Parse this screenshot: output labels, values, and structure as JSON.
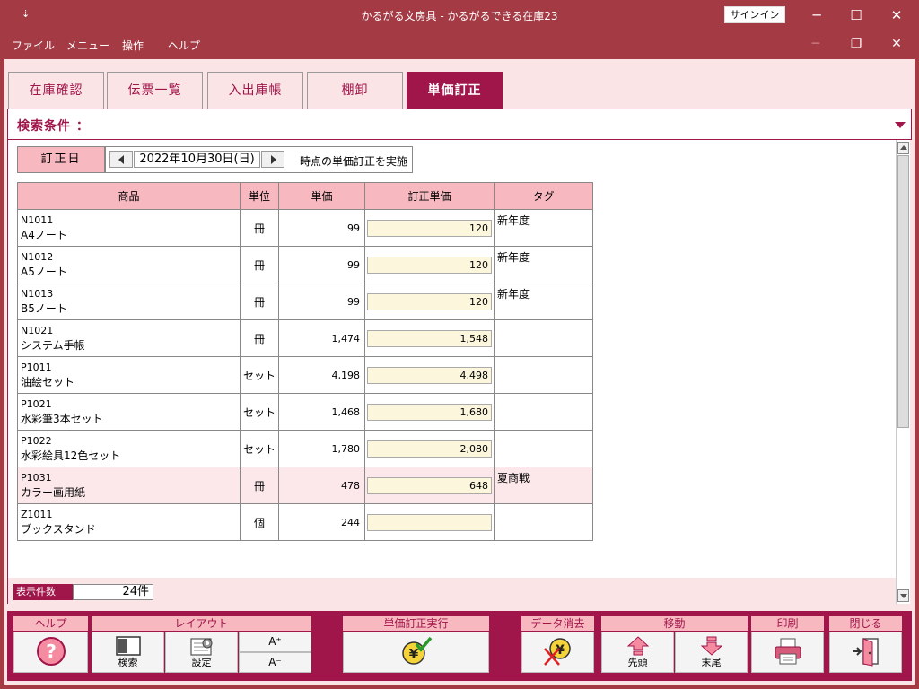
{
  "window": {
    "quick_access": "⇣",
    "title": "かるがる文房具  -  かるがるできる在庫23",
    "signin": "サインイン",
    "minimize": "─",
    "maximize": "☐",
    "close": "✕"
  },
  "menu": {
    "items": [
      "ファイル",
      "メニュー",
      "操作",
      "ヘルプ"
    ],
    "doc_minimize": "─",
    "doc_restore": "❐",
    "doc_close": "✕"
  },
  "tabs": [
    "在庫確認",
    "伝票一覧",
    "入出庫帳",
    "棚卸",
    "単価訂正"
  ],
  "active_tab": "単価訂正",
  "search": {
    "label": "検索条件 ："
  },
  "date_filter": {
    "label": "訂正日",
    "value": "2022年10月30日(日)",
    "note": "時点の単価訂正を実施"
  },
  "table": {
    "headers": [
      "商品",
      "単位",
      "単価",
      "訂正単価",
      "タグ"
    ],
    "rows": [
      {
        "code": "N1011",
        "name": "A4ノート",
        "unit": "冊",
        "price": "99",
        "corrected": "120",
        "tag": "新年度"
      },
      {
        "code": "N1012",
        "name": "A5ノート",
        "unit": "冊",
        "price": "99",
        "corrected": "120",
        "tag": "新年度"
      },
      {
        "code": "N1013",
        "name": "B5ノート",
        "unit": "冊",
        "price": "99",
        "corrected": "120",
        "tag": "新年度"
      },
      {
        "code": "N1021",
        "name": "システム手帳",
        "unit": "冊",
        "price": "1,474",
        "corrected": "1,548",
        "tag": ""
      },
      {
        "code": "P1011",
        "name": "油絵セット",
        "unit": "セット",
        "price": "4,198",
        "corrected": "4,498",
        "tag": ""
      },
      {
        "code": "P1021",
        "name": "水彩筆3本セット",
        "unit": "セット",
        "price": "1,468",
        "corrected": "1,680",
        "tag": ""
      },
      {
        "code": "P1022",
        "name": "水彩絵具12色セット",
        "unit": "セット",
        "price": "1,780",
        "corrected": "2,080",
        "tag": ""
      },
      {
        "code": "P1031",
        "name": "カラー画用紙",
        "unit": "冊",
        "price": "478",
        "corrected": "648",
        "tag": "夏商戦"
      },
      {
        "code": "Z1011",
        "name": "ブックスタンド",
        "unit": "個",
        "price": "244",
        "corrected": "",
        "tag": ""
      }
    ]
  },
  "count": {
    "label": "表示件数",
    "value": "24件"
  },
  "toolbar": {
    "help": {
      "header": "ヘルプ"
    },
    "layout": {
      "header": "レイアウト",
      "search": "検索",
      "settings": "設定",
      "font_up": "A⁺",
      "font_down": "A⁻"
    },
    "execute": {
      "header": "単価訂正実行"
    },
    "delete": {
      "header": "データ消去"
    },
    "move": {
      "header": "移動",
      "first": "先頭",
      "last": "末尾"
    },
    "print": {
      "header": "印刷"
    },
    "close": {
      "header": "閉じる"
    }
  }
}
